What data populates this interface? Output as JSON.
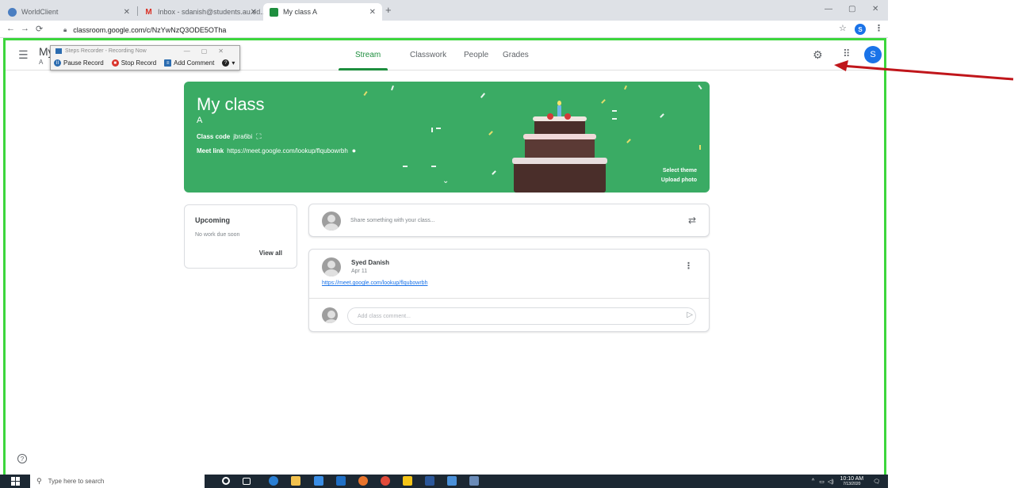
{
  "browser": {
    "tabs": [
      {
        "title": "WorldClient",
        "favicon_color": "#4a7ec1"
      },
      {
        "title": "Inbox - sdanish@students.au.ed...",
        "favicon_color": "#d93025",
        "favicon_glyph": "M"
      },
      {
        "title": "My class A",
        "favicon_color": "#1e8e3e"
      }
    ],
    "url": "classroom.google.com/c/NzYwNzQ3ODE5OTha",
    "profile_initial": "S"
  },
  "classroom": {
    "header_title": "My",
    "header_subtitle": "A",
    "nav_tabs": [
      "Stream",
      "Classwork",
      "People",
      "Grades"
    ],
    "active_tab": "Stream",
    "account_initial": "S"
  },
  "steps_recorder": {
    "title": "Steps Recorder - Recording Now",
    "pause": "Pause Record",
    "stop": "Stop Record",
    "add_comment": "Add Comment"
  },
  "banner": {
    "title": "My class",
    "section": "A",
    "class_code_label": "Class code",
    "class_code": "jbra6bi",
    "meet_label": "Meet link",
    "meet_link": "https://meet.google.com/lookup/flqubowrbh",
    "select_theme": "Select theme",
    "upload_photo": "Upload photo",
    "color": "#3aab64"
  },
  "upcoming": {
    "title": "Upcoming",
    "empty": "No work due soon",
    "view_all": "View all"
  },
  "share": {
    "placeholder": "Share something with your class..."
  },
  "post": {
    "author": "Syed Danish",
    "date": "Apr 11",
    "link": "https://meet.google.com/lookup/flqubowrbh",
    "comment_placeholder": "Add class comment..."
  },
  "taskbar": {
    "search_placeholder": "Type here to search",
    "time": "10:10 AM",
    "date": "7/13/2020"
  },
  "annotation": {
    "arrow_color": "#c0161b"
  }
}
